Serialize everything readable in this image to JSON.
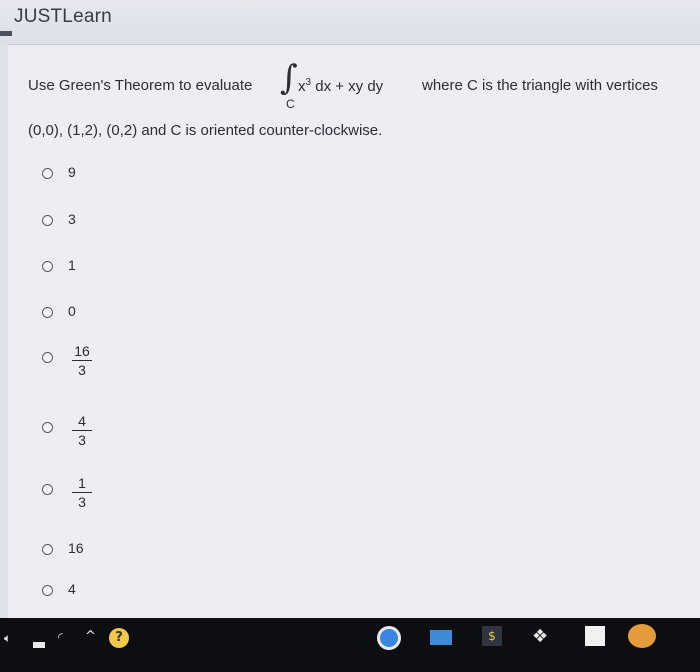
{
  "app": {
    "title": "JUSTLearn"
  },
  "question": {
    "prefix": "Use Green's Theorem to evaluate",
    "integral_symbol": "∫",
    "integral_subscript": "C",
    "integrand_x": "x",
    "integrand_x_exp": "3",
    "integrand_rest": " dx + xy dy",
    "suffix": "where C is the triangle with vertices",
    "line2": "(0,0), (1,2), (0,2) and C is oriented counter-clockwise."
  },
  "options": [
    {
      "label": "9"
    },
    {
      "label": "3"
    },
    {
      "label": "1"
    },
    {
      "label": "0"
    },
    {
      "numerator": "16",
      "denominator": "3"
    },
    {
      "numerator": "4",
      "denominator": "3"
    },
    {
      "numerator": "1",
      "denominator": "3"
    },
    {
      "label": "16"
    },
    {
      "label": "4"
    }
  ],
  "taskbar": {
    "icons": [
      "speaker-icon",
      "battery-icon",
      "wifi-icon",
      "chevron-up-icon",
      "help-icon",
      "chrome-icon",
      "files-icon",
      "app-icon",
      "dropbox-icon",
      "badge-icon",
      "mail-icon"
    ]
  }
}
